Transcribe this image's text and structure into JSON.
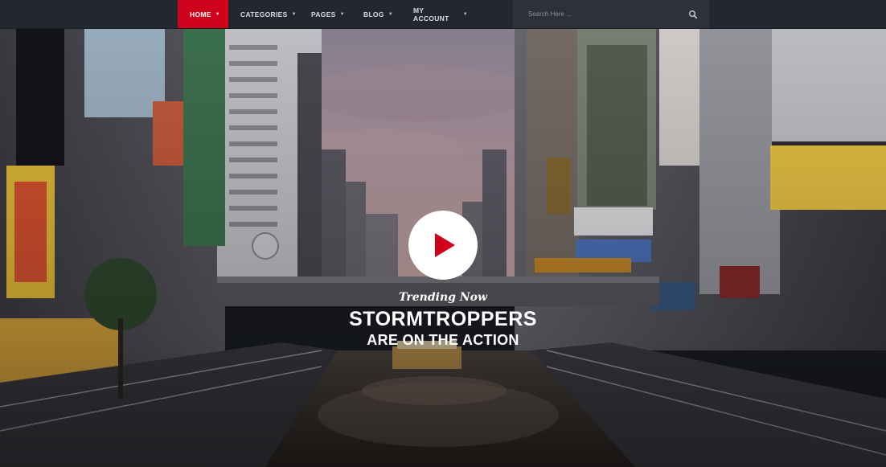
{
  "nav": {
    "items": [
      {
        "label": "HOME",
        "active": true
      },
      {
        "label": "CATEGORIES",
        "active": false
      },
      {
        "label": "PAGES",
        "active": false
      },
      {
        "label": "BLOG",
        "active": false
      },
      {
        "label": "MY ACCOUNT",
        "active": false
      }
    ],
    "search": {
      "placeholder": "Search Here ...",
      "icon": "search-icon"
    }
  },
  "hero": {
    "trending_label": "Trending Now",
    "headline_line1": "STORMTROPPERS",
    "headline_line2": "ARE ON THE ACTION",
    "play_icon": "play-icon"
  },
  "colors": {
    "accent": "#d0021b",
    "nav_bg": "#23272f",
    "search_bg": "#2c313a"
  }
}
